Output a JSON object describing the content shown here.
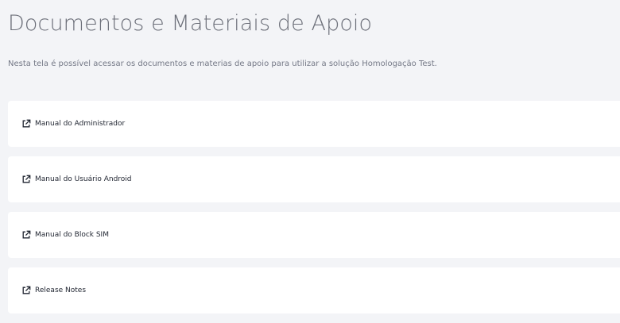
{
  "page": {
    "title": "Documentos e Materiais de Apoio",
    "subtitle": "Nesta tela é possível acessar os documentos e materias de apoio para utilizar a solução Homologação Test."
  },
  "documents": [
    {
      "label": "Manual do Administrador",
      "icon": "external-link-icon"
    },
    {
      "label": "Manual do Usuário Android",
      "icon": "external-link-icon"
    },
    {
      "label": "Manual do Block SIM",
      "icon": "external-link-icon"
    },
    {
      "label": "Release Notes",
      "icon": "external-link-icon"
    }
  ],
  "colors": {
    "background": "#f3f4f7",
    "card": "#ffffff",
    "title": "#6c6f79",
    "subtitle": "#747886",
    "label": "#1f2430"
  }
}
